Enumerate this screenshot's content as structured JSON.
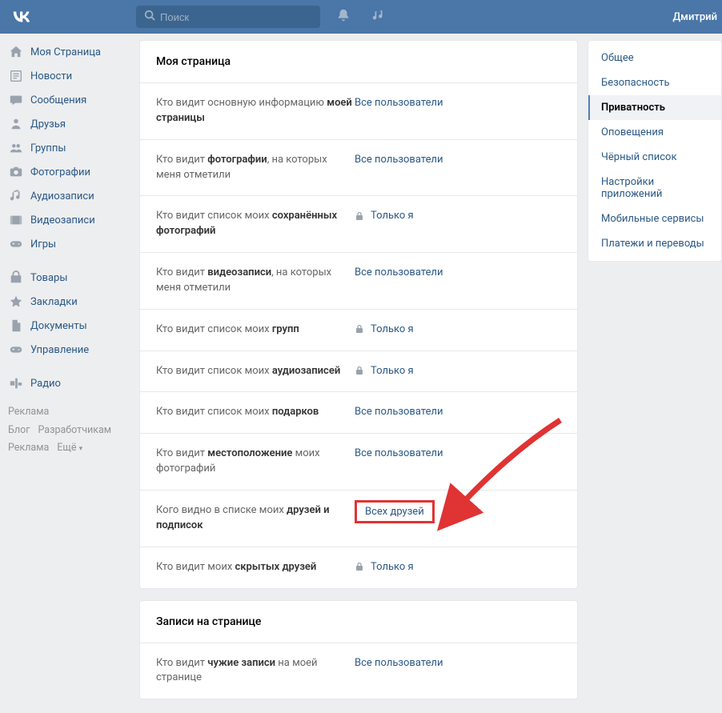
{
  "header": {
    "logo": "VK",
    "search_placeholder": "Поиск",
    "username": "Дмитрий"
  },
  "left_nav": [
    {
      "icon": "home",
      "label": "Моя Страница"
    },
    {
      "icon": "news",
      "label": "Новости"
    },
    {
      "icon": "msg",
      "label": "Сообщения"
    },
    {
      "icon": "friends",
      "label": "Друзья"
    },
    {
      "icon": "groups",
      "label": "Группы"
    },
    {
      "icon": "photo",
      "label": "Фотографии"
    },
    {
      "icon": "audio",
      "label": "Аудиозаписи"
    },
    {
      "icon": "video",
      "label": "Видеозаписи"
    },
    {
      "icon": "games",
      "label": "Игры"
    },
    {
      "sep": true
    },
    {
      "icon": "market",
      "label": "Товары"
    },
    {
      "icon": "bookmark",
      "label": "Закладки"
    },
    {
      "icon": "docs",
      "label": "Документы"
    },
    {
      "icon": "games",
      "label": "Управление"
    },
    {
      "sep": true
    },
    {
      "icon": "radio",
      "label": "Радио"
    }
  ],
  "footer": {
    "line1a": "Реклама",
    "line2a": "Блог",
    "line2b": "Разработчикам",
    "line3a": "Реклама",
    "line3b": "Ещё"
  },
  "sections": [
    {
      "title": "Моя страница",
      "rows": [
        {
          "text": "Кто видит основную информацию ",
          "bold": "моей страницы",
          "value": "Все пользователи",
          "lock": false
        },
        {
          "text": "Кто видит ",
          "bold": "фотографии",
          "tail": ", на которых меня отметили",
          "value": "Все пользователи",
          "lock": false
        },
        {
          "text": "Кто видит список моих ",
          "bold": "сохранённых фотографий",
          "value": "Только я",
          "lock": true
        },
        {
          "text": "Кто видит ",
          "bold": "видеозаписи",
          "tail": ", на которых меня отметили",
          "value": "Все пользователи",
          "lock": false
        },
        {
          "text": "Кто видит список моих ",
          "bold": "групп",
          "value": "Только я",
          "lock": true
        },
        {
          "text": "Кто видит список моих ",
          "bold": "аудиозаписей",
          "value": "Только я",
          "lock": true
        },
        {
          "text": "Кто видит список моих ",
          "bold": "подарков",
          "value": "Все пользователи",
          "lock": false
        },
        {
          "text": "Кто видит ",
          "bold": "местоположение",
          "tail": " моих фотографий",
          "value": "Все пользователи",
          "lock": false
        },
        {
          "text": "Кого видно в списке моих ",
          "bold": "друзей и подписок",
          "value": "Всех друзей",
          "lock": false,
          "highlight": true
        },
        {
          "text": "Кто видит моих ",
          "bold": "скрытых друзей",
          "value": "Только я",
          "lock": true
        }
      ]
    },
    {
      "title": "Записи на странице",
      "rows": [
        {
          "text": "Кто видит ",
          "bold": "чужие записи",
          "tail": " на моей странице",
          "value": "Все пользователи",
          "lock": false
        }
      ]
    }
  ],
  "right_nav": [
    {
      "label": "Общее"
    },
    {
      "label": "Безопасность"
    },
    {
      "label": "Приватность",
      "active": true
    },
    {
      "label": "Оповещения"
    },
    {
      "label": "Чёрный список"
    },
    {
      "label": "Настройки приложений"
    },
    {
      "label": "Мобильные сервисы"
    },
    {
      "label": "Платежи и переводы"
    }
  ]
}
